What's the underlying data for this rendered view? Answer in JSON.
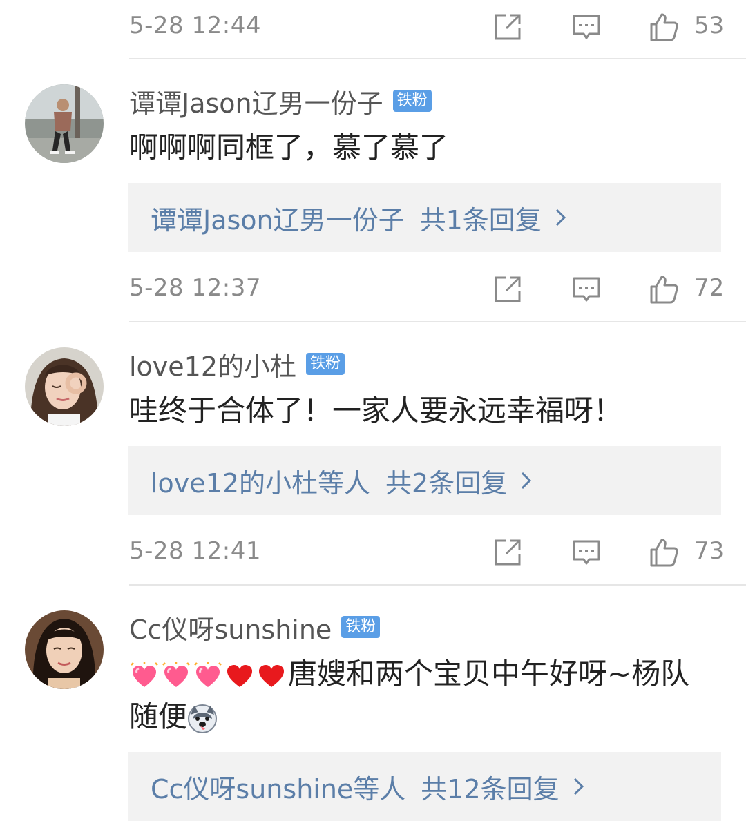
{
  "top_meta": {
    "time": "5-28 12:44",
    "likes": "53"
  },
  "comments": [
    {
      "username": "谭谭Jason辽男一份子",
      "badge": "铁粉",
      "text": "啊啊啊同框了，慕了慕了",
      "replies": {
        "who": "谭谭Jason辽男一份子",
        "count_text": "共1条回复"
      },
      "time": "5-28 12:37",
      "likes": "72"
    },
    {
      "username": "love12的小杜",
      "badge": "铁粉",
      "text": "哇终于合体了！一家人要永远幸福呀！",
      "replies": {
        "who": "love12的小杜等人",
        "count_text": "共2条回复"
      },
      "time": "5-28 12:41",
      "likes": "73"
    },
    {
      "username": "Cc仪呀sunshine",
      "badge": "铁粉",
      "text_main": "唐嫂和两个宝贝中午好呀~杨队",
      "text_tail": "随便",
      "replies": {
        "who": "Cc仪呀sunshine等人",
        "count_text": "共12条回复"
      }
    }
  ],
  "icons": {
    "share": "share-icon",
    "reply": "comment-icon",
    "like": "thumbs-up-icon",
    "chevron": "chevron-right-icon",
    "emoji_heart": "heart-sparkle-emoji",
    "emoji_red_heart": "red-heart-emoji",
    "emoji_husky": "husky-emoji"
  },
  "colors": {
    "badge": "#5a9ee6",
    "link": "#5b7ea8",
    "meta": "#8a8a8a",
    "divider": "#e6e6e6"
  }
}
